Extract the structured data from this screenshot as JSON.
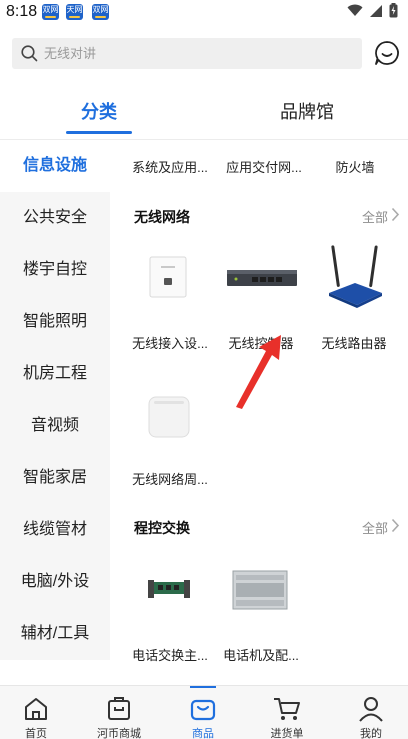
{
  "status_bar": {
    "time": "8:18",
    "notifications": [
      "双网",
      "天网",
      "双网"
    ]
  },
  "search": {
    "placeholder": "无线对讲"
  },
  "tabs": [
    {
      "label": "分类",
      "active": true
    },
    {
      "label": "品牌馆",
      "active": false
    }
  ],
  "sidebar": {
    "items": [
      {
        "label": "信息设施",
        "active": true
      },
      {
        "label": "公共安全"
      },
      {
        "label": "楼宇自控"
      },
      {
        "label": "智能照明"
      },
      {
        "label": "机房工程"
      },
      {
        "label": "音视频"
      },
      {
        "label": "智能家居"
      },
      {
        "label": "线缆管材"
      },
      {
        "label": "电脑/外设"
      },
      {
        "label": "辅材/工具"
      }
    ]
  },
  "content": {
    "top_row": [
      "系统及应用...",
      "应用交付网...",
      "防火墙"
    ],
    "sections": [
      {
        "title": "无线网络",
        "more": "全部",
        "items": [
          {
            "label": "无线接入设...",
            "icon": "wall-access-point-icon"
          },
          {
            "label": "无线控制器",
            "icon": "wireless-controller-icon"
          },
          {
            "label": "无线路由器",
            "icon": "wireless-router-icon"
          },
          {
            "label": "无线网络周...",
            "icon": "network-peripheral-icon"
          }
        ]
      },
      {
        "title": "程控交换",
        "more": "全部",
        "items": [
          {
            "label": "电话交换主...",
            "icon": "switch-board-icon"
          },
          {
            "label": "电话机及配...",
            "icon": "pbx-cabinet-icon"
          }
        ]
      }
    ]
  },
  "bottom_nav": [
    {
      "label": "首页",
      "icon": "home-icon"
    },
    {
      "label": "河币商城",
      "icon": "store-icon"
    },
    {
      "label": "商品",
      "icon": "goods-icon",
      "active": true
    },
    {
      "label": "进货单",
      "icon": "cart-icon"
    },
    {
      "label": "我的",
      "icon": "profile-icon"
    }
  ],
  "colors": {
    "accent": "#1f6fde",
    "annotation_arrow": "#e8302a",
    "sidebar_bg": "#f6f6f6"
  }
}
